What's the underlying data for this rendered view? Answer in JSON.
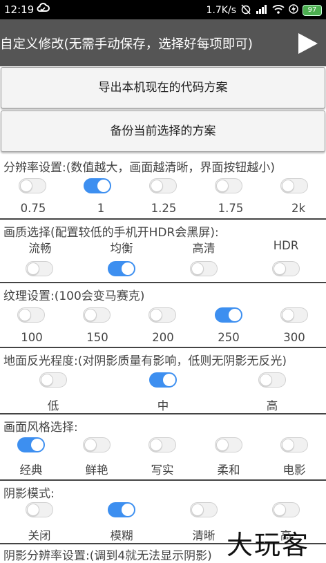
{
  "status_bar": {
    "time": "12:19",
    "speed": "1.7K/s",
    "battery": "97",
    "icons": [
      "cloud-icon",
      "alarm-off-icon",
      "signal-icon",
      "wifi-icon",
      "charging-icon",
      "battery-icon"
    ]
  },
  "header": {
    "title": "自定义修改(无需手动保存，选择好每项即可)",
    "play_icon": "play-icon"
  },
  "buttons": {
    "export": "导出本机现在的代码方案",
    "backup": "备份当前选择的方案"
  },
  "resolution": {
    "title": "分辨率设置:(数值越大，画面越清晰，界面按钮越小)",
    "options": [
      "0.75",
      "1",
      "1.25",
      "1.75",
      "2k"
    ],
    "selected": [
      false,
      true,
      false,
      false,
      false
    ]
  },
  "quality": {
    "title": "画质选择(配置较低的手机开HDR会黑屏):",
    "options": [
      "流畅",
      "均衡",
      "高清",
      "HDR"
    ],
    "selected": [
      false,
      true,
      false,
      false
    ]
  },
  "texture": {
    "title": "纹理设置:(100会变马赛克)",
    "options": [
      "100",
      "150",
      "200",
      "250",
      "300"
    ],
    "selected": [
      false,
      false,
      false,
      true,
      false
    ]
  },
  "reflection": {
    "title": "地面反光程度:(对阴影质量有影响，低则无阴影无反光)",
    "options": [
      "低",
      "中",
      "高"
    ],
    "selected": [
      false,
      true,
      false
    ]
  },
  "style": {
    "title": "画面风格选择:",
    "options": [
      "经典",
      "鲜艳",
      "写实",
      "柔和",
      "电影"
    ],
    "selected": [
      true,
      false,
      false,
      false,
      false
    ]
  },
  "shadow": {
    "title": "阴影模式:",
    "options": [
      "关闭",
      "模糊",
      "清晰",
      "高"
    ],
    "selected": [
      false,
      true,
      false,
      false
    ]
  },
  "shadow_resolution": {
    "title": "阴影分辨率设置:(调到4就无法显示阴影)"
  },
  "watermark": "大玩客",
  "colors": {
    "accent": "#3d8ff0",
    "header_bg": "#555555",
    "status_bg": "#000000"
  }
}
